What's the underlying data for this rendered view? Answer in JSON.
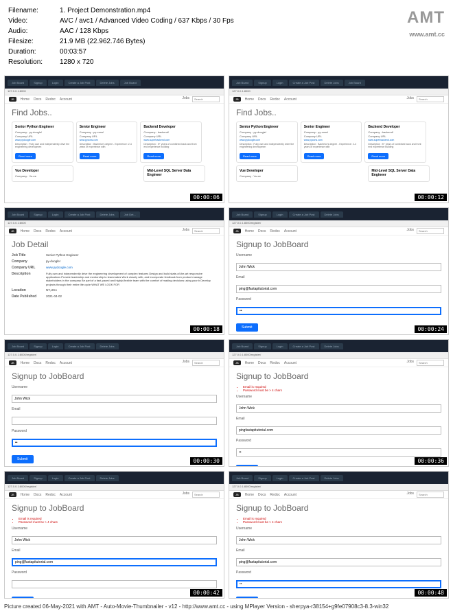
{
  "metadata": {
    "filename_label": "Filename:",
    "filename": "1. Project Demonstration.mp4",
    "video_label": "Video:",
    "video": "AVC / avc1 / Advanced Video Coding / 637 Kbps / 30 Fps",
    "audio_label": "Audio:",
    "audio": "AAC / 128 Kbps",
    "filesize_label": "Filesize:",
    "filesize": "21.9 MB (22.962.746 Bytes)",
    "duration_label": "Duration:",
    "duration": "00:03:57",
    "resolution_label": "Resolution:",
    "resolution": "1280 x 720"
  },
  "logo": {
    "text": "AMT",
    "url": "www.amt.cc"
  },
  "tabs": [
    "Job Board",
    "Signup",
    "Login",
    "Create a Job Post",
    "Delete Jobs",
    "Job Board",
    "Job Det..."
  ],
  "nav": {
    "logo": "JB",
    "home": "Home",
    "docs": "Docs",
    "redoc": "Redoc",
    "account": "Account",
    "jobs": "Jobs",
    "search": "Search"
  },
  "address1": "127.0.0.1:8000",
  "address2": "127.0.0.1:8000/register/",
  "findjobs_title": "Find Jobs..",
  "signup_title": "Signup to JobBoard",
  "jobdetail_title": "Job Detail",
  "cards": [
    {
      "title": "Senior Python Engineer",
      "company": "Company : py-doogle!",
      "url_label": "Company URL",
      "url": "www.pydoogle.com",
      "desc": "Description : Fully own and independently drive the engineering developmen"
    },
    {
      "title": "Senior Engineer",
      "company": "Company : py-cons!",
      "url_label": "Company URL",
      "url": "www.pycons.com",
      "desc": "Description : Bachelor's degree - Experience: 2-4 years of experience with"
    },
    {
      "title": "Backend Developer",
      "company": "Company : backend!",
      "url_label": "Company URL",
      "url": "www.superbackend.com",
      "desc": "Description : 5+ years of combined back and front end experience building"
    },
    {
      "title": "Vue Developer",
      "company": "Company : Vu-ee"
    },
    {
      "title": "Mid-Level SQL Server Data Engineer",
      "company": ""
    }
  ],
  "readmore": "Read more",
  "detail": {
    "jobtitle_lbl": "Job Title",
    "jobtitle": "Senior Python Engineer",
    "company_lbl": "Company",
    "company": "py-doogle!",
    "url_lbl": "Company URL",
    "url": "www.pydoogle.com",
    "desc_lbl": "Description",
    "desc": "Fully own and independently drive the engineering development of complex features Design and build state-of-the-art responsive applications Provide leadership and mentorship to teammates Work closely with, and incorporate feedback from product manage stakeholders in the company Be part of a fast-paced and highly-flexible team with the comfort of making decisions using your b Develop projects through their entire life cycle WHAT WE LOOK FOR",
    "loc_lbl": "Location",
    "loc": "NY,USA",
    "date_lbl": "Date Published",
    "date": "2021-04-02"
  },
  "form": {
    "username_lbl": "Username",
    "username_val": "John Wick",
    "email_lbl": "Email",
    "email_val": "ping@fastapitutorial.com",
    "email_val2": "pingfastapitutorial.com",
    "password_lbl": "Password",
    "password_val": "••",
    "submit": "Submit"
  },
  "errors": {
    "e1": "Email is required",
    "e2": "Password must be > 4 chars"
  },
  "timestamps": [
    "00:00:06",
    "00:00:12",
    "00:00:18",
    "00:00:24",
    "00:00:30",
    "00:00:36",
    "00:00:42",
    "00:00:48"
  ],
  "footer": "Picture created 06-May-2021 with AMT - Auto-Movie-Thumbnailer - v12 - http://www.amt.cc - using MPlayer Version - sherpya-r38154+g9fe07908c3-8.3-win32"
}
